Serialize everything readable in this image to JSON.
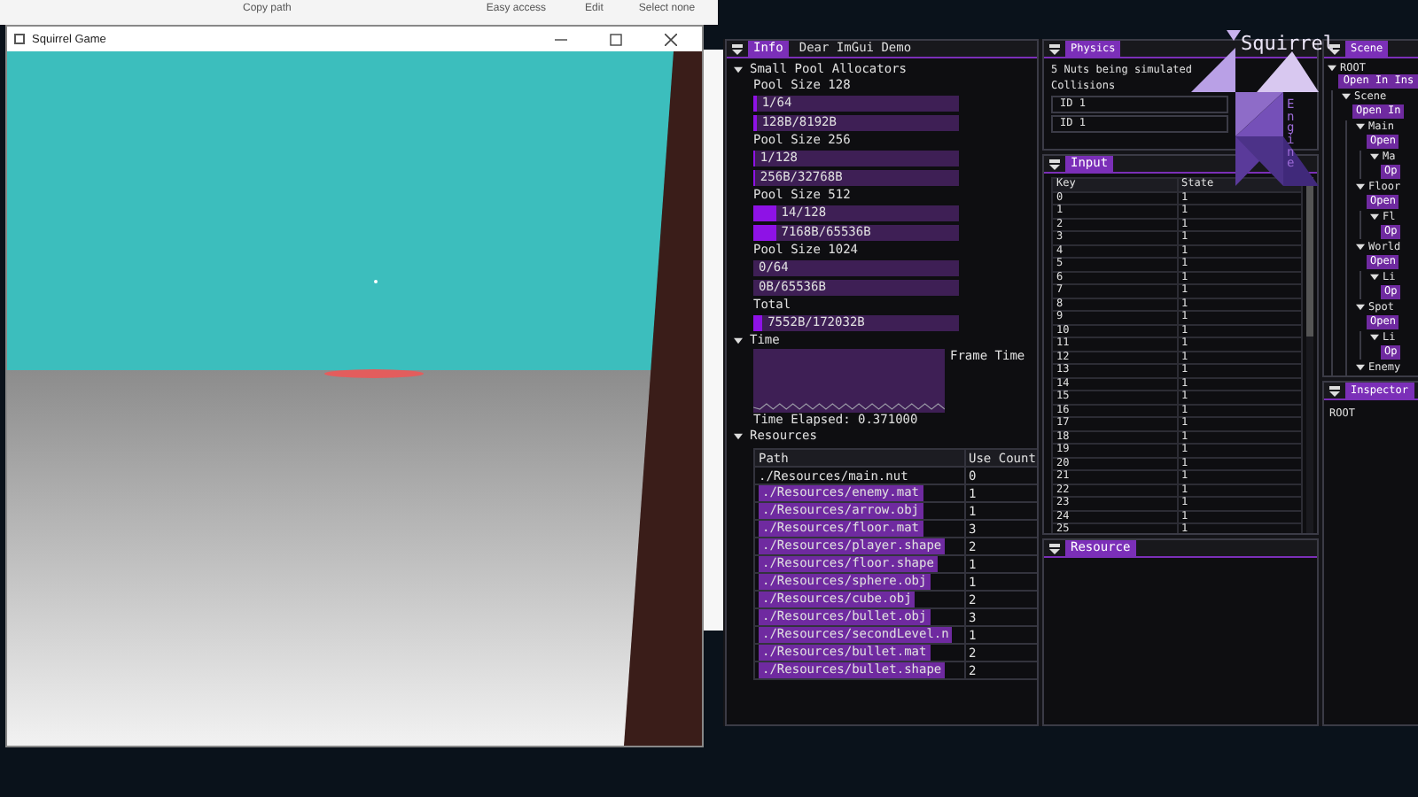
{
  "background_ribbon": {
    "items": [
      "Copy path",
      "Easy access",
      "Edit",
      "Select none"
    ]
  },
  "game_window": {
    "title": "Squirrel Game"
  },
  "logo": {
    "title": "Squirrel",
    "subtitle": "Engine"
  },
  "info_panel": {
    "tabs": [
      {
        "label": "Info",
        "selected": true
      },
      {
        "label": "Dear ImGui Demo",
        "selected": false
      }
    ],
    "allocators": {
      "header": "Small Pool Allocators",
      "expanded": true,
      "pools": [
        {
          "title": "Pool Size 128",
          "bars": [
            {
              "text": "1/64",
              "level": 0.016
            },
            {
              "text": "128B/8192B",
              "level": 0.016
            }
          ]
        },
        {
          "title": "Pool Size 256",
          "bars": [
            {
              "text": "1/128",
              "level": 0.008
            },
            {
              "text": "256B/32768B",
              "level": 0.008
            }
          ]
        },
        {
          "title": "Pool Size 512",
          "bars": [
            {
              "text": "14/128",
              "level": 0.11
            },
            {
              "text": "7168B/65536B",
              "level": 0.11
            }
          ]
        },
        {
          "title": "Pool Size 1024",
          "bars": [
            {
              "text": "0/64",
              "level": 0
            },
            {
              "text": "0B/65536B",
              "level": 0
            }
          ]
        },
        {
          "title": "Total",
          "bars": [
            {
              "text": "7552B/172032B",
              "level": 0.044
            }
          ]
        }
      ]
    },
    "time": {
      "header": "Time",
      "expanded": true,
      "plot_label": "Frame Time",
      "elapsed": "Time Elapsed: 0.371000"
    },
    "resources": {
      "header": "Resources",
      "expanded": true,
      "columns": [
        "Path",
        "Use Count"
      ],
      "rows": [
        {
          "path": "./Resources/main.nut",
          "count": "0",
          "highlighted": false
        },
        {
          "path": "./Resources/enemy.mat",
          "count": "1",
          "highlighted": true
        },
        {
          "path": "./Resources/arrow.obj",
          "count": "1",
          "highlighted": true
        },
        {
          "path": "./Resources/floor.mat",
          "count": "3",
          "highlighted": true
        },
        {
          "path": "./Resources/player.shape",
          "count": "2",
          "highlighted": true
        },
        {
          "path": "./Resources/floor.shape",
          "count": "1",
          "highlighted": true
        },
        {
          "path": "./Resources/sphere.obj",
          "count": "1",
          "highlighted": true
        },
        {
          "path": "./Resources/cube.obj",
          "count": "2",
          "highlighted": true
        },
        {
          "path": "./Resources/bullet.obj",
          "count": "3",
          "highlighted": true
        },
        {
          "path": "./Resources/secondLevel.n",
          "count": "1",
          "highlighted": true
        },
        {
          "path": "./Resources/bullet.mat",
          "count": "2",
          "highlighted": true
        },
        {
          "path": "./Resources/bullet.shape",
          "count": "2",
          "highlighted": true
        }
      ]
    }
  },
  "physics_panel": {
    "tabs": [
      {
        "label": "Physics",
        "selected": true
      }
    ],
    "summary": "5 Nuts being simulated",
    "collisions_label": "Collisions",
    "collisions": [
      "ID 1",
      "ID 1"
    ]
  },
  "input_panel": {
    "tabs": [
      {
        "label": "Input",
        "selected": true
      }
    ],
    "columns": [
      "Key",
      "State"
    ],
    "rows": [
      [
        "0",
        "1"
      ],
      [
        "1",
        "1"
      ],
      [
        "2",
        "1"
      ],
      [
        "3",
        "1"
      ],
      [
        "4",
        "1"
      ],
      [
        "5",
        "1"
      ],
      [
        "6",
        "1"
      ],
      [
        "7",
        "1"
      ],
      [
        "8",
        "1"
      ],
      [
        "9",
        "1"
      ],
      [
        "10",
        "1"
      ],
      [
        "11",
        "1"
      ],
      [
        "12",
        "1"
      ],
      [
        "13",
        "1"
      ],
      [
        "14",
        "1"
      ],
      [
        "15",
        "1"
      ],
      [
        "16",
        "1"
      ],
      [
        "17",
        "1"
      ],
      [
        "18",
        "1"
      ],
      [
        "19",
        "1"
      ],
      [
        "20",
        "1"
      ],
      [
        "21",
        "1"
      ],
      [
        "22",
        "1"
      ],
      [
        "23",
        "1"
      ],
      [
        "24",
        "1"
      ],
      [
        "25",
        "1"
      ]
    ]
  },
  "resource_panel": {
    "tabs": [
      {
        "label": "Resource",
        "selected": true
      }
    ]
  },
  "scene_panel": {
    "tabs": [
      {
        "label": "Scene",
        "selected": true
      }
    ],
    "tree": [
      {
        "label": "ROOT",
        "button": "Open In Ins",
        "expanded": true,
        "children": [
          {
            "label": "Scene",
            "button": "Open In",
            "expanded": true,
            "children": [
              {
                "label": "Main",
                "button": "Open",
                "expanded": true,
                "children": [
                  {
                    "label": "Ma",
                    "button": "Op",
                    "expanded": true
                  }
                ]
              },
              {
                "label": "Floor",
                "button": "Open",
                "expanded": true,
                "children": [
                  {
                    "label": "Fl",
                    "button": "Op",
                    "expanded": true
                  }
                ]
              },
              {
                "label": "World",
                "button": "Open",
                "expanded": true,
                "children": [
                  {
                    "label": "Li",
                    "button": "Op",
                    "expanded": true
                  }
                ]
              },
              {
                "label": "Spot",
                "button": "Open",
                "expanded": true,
                "children": [
                  {
                    "label": "Li",
                    "button": "Op",
                    "expanded": true
                  }
                ]
              },
              {
                "label": "Enemy",
                "expanded": true
              }
            ]
          }
        ]
      }
    ]
  },
  "inspector_panel": {
    "tabs": [
      {
        "label": "Inspector",
        "selected": true
      }
    ],
    "text": "ROOT"
  }
}
